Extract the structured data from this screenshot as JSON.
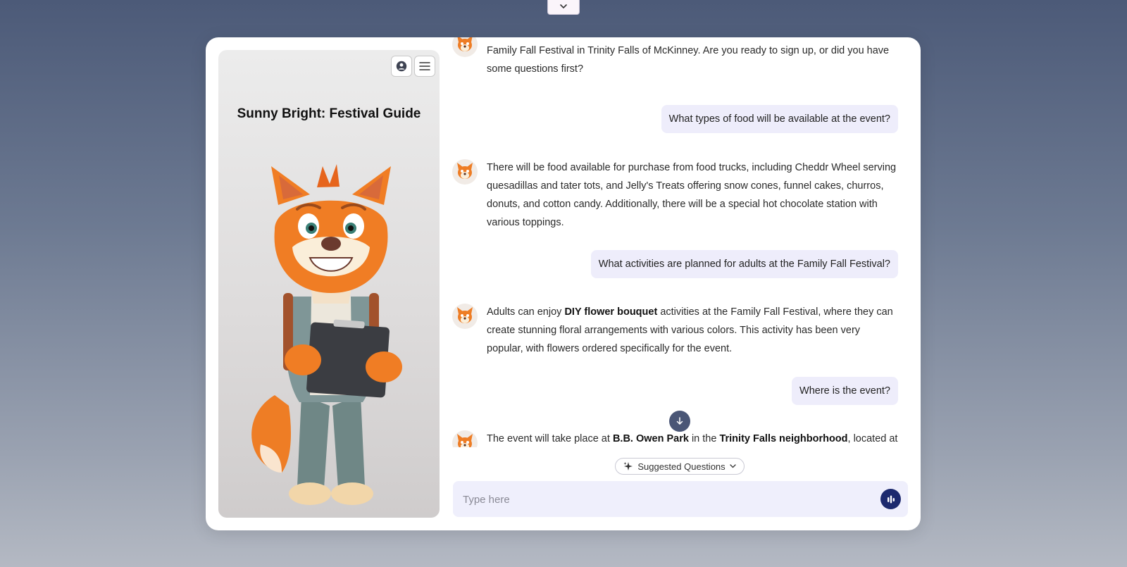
{
  "panel": {
    "title": "Sunny Bright: Festival Guide"
  },
  "messages": {
    "bot1_text": "Family Fall Festival in Trinity Falls of McKinney. Are you ready to sign up, or did you have some questions first?",
    "user1": "What types of food will be available at the event?",
    "bot2_text": "There will be food available for purchase from food trucks, including Cheddr Wheel serving quesadillas and tater tots, and Jelly's Treats offering snow cones, funnel cakes, churros, donuts, and cotton candy. Additionally, there will be a special hot chocolate station with various toppings.",
    "user2": "What activities are planned for adults at the Family Fall Festival?",
    "bot3": {
      "pre": "Adults can enjoy ",
      "bold": "DIY flower bouquet",
      "post": " activities at the Family Fall Festival, where they can create stunning floral arrangements with various colors. This activity has been very popular, with flowers ordered specifically for the event."
    },
    "user3": "Where is the event?",
    "bot4": {
      "pre": "The event will take place at ",
      "bold1": "B.B. Owen Park",
      "mid": " in the ",
      "bold2": "Trinity Falls neighborhood",
      "post": ", located at"
    }
  },
  "suggested": {
    "label": "Suggested Questions"
  },
  "composer": {
    "placeholder": "Type here",
    "value": ""
  },
  "colors": {
    "accent": "#1d2a6e",
    "user_bubble": "#eeedfb",
    "scroll_button": "#4a5676"
  },
  "icons": {
    "top_toggle": "chevron-down-icon",
    "account": "user-circle-icon",
    "menu": "hamburger-menu-icon",
    "scroll": "arrow-down-icon",
    "suggested": "sparkle-icon",
    "suggested_caret": "chevron-down-icon",
    "voice": "audio-bars-icon"
  }
}
